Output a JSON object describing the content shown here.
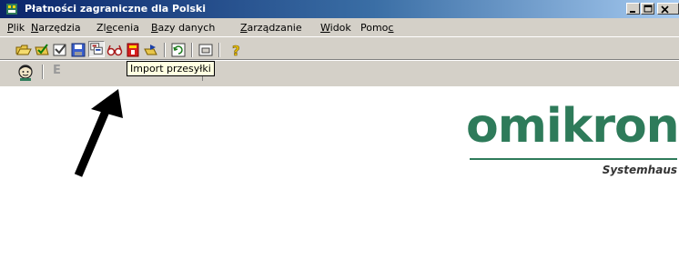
{
  "window": {
    "title": "Płatności zagraniczne dla Polski"
  },
  "menu": [
    {
      "pre": "",
      "acc": "P",
      "post": "lik"
    },
    {
      "pre": "",
      "acc": "N",
      "post": "arzędzia"
    },
    {
      "pre": "Zl",
      "acc": "e",
      "post": "cenia"
    },
    {
      "pre": "",
      "acc": "B",
      "post": "azy danych"
    },
    {
      "pre": "",
      "acc": "Z",
      "post": "arządzanie"
    },
    {
      "pre": "",
      "acc": "W",
      "post": "idok"
    },
    {
      "pre": "Pomo",
      "acc": "c",
      "post": ""
    }
  ],
  "toolbar": {
    "icons": [
      "folder-open-icon",
      "checklist-icon",
      "verify-icon",
      "save-icon",
      "import-icon",
      "search-glasses-icon",
      "book-icon",
      "export-icon",
      "refresh-icon",
      "window-icon",
      "help-icon"
    ],
    "tooltip": "Import przesyłki",
    "row2_letter": "E"
  },
  "logo": {
    "word": "omikron",
    "sub": "Systemhaus",
    "color": "#2e7b5a"
  }
}
